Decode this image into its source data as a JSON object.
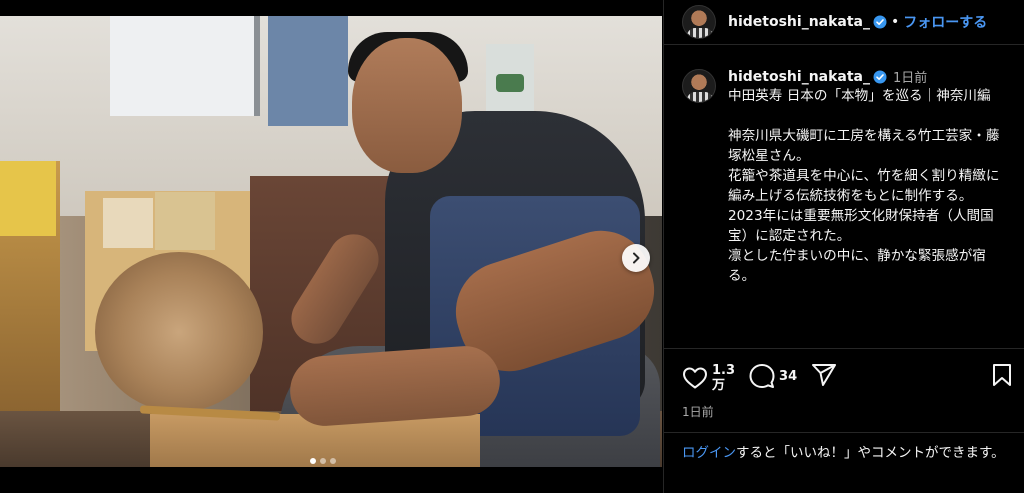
{
  "post": {
    "username": "hidetoshi_nakata_",
    "follow_label": "フォローする",
    "separator": "•"
  },
  "caption": {
    "username": "hidetoshi_nakata_",
    "time": "1日前",
    "lines": [
      "中田英寿 日本の「本物」を巡る｜神奈川編",
      "",
      "神奈川県大磯町に工房を構える竹工芸家・藤塚松星さん。",
      "花籠や茶道具を中心に、竹を細く割り精緻に編み上げる伝統技術をもとに制作する。",
      "2023年には重要無形文化財保持者（人間国宝）に認定された。",
      "凛とした佇まいの中に、静かな緊張感が宿る。"
    ]
  },
  "actions": {
    "likes_line1": "1.3",
    "likes_line2": "万",
    "comments": "34",
    "posted": "1日前"
  },
  "login": {
    "link": "ログイン",
    "rest": "すると「いいね！」やコメントができます。"
  },
  "carousel": {
    "slides": 3,
    "active": 0
  },
  "icons": {
    "heart": "heart-icon",
    "comment": "comment-icon",
    "share": "share-icon",
    "bookmark": "bookmark-icon",
    "verified": "verified-badge-icon",
    "next": "chevron-right-icon"
  },
  "colors": {
    "link": "#4a97f3",
    "verified": "#3897f0",
    "muted": "#a8a8a8"
  }
}
